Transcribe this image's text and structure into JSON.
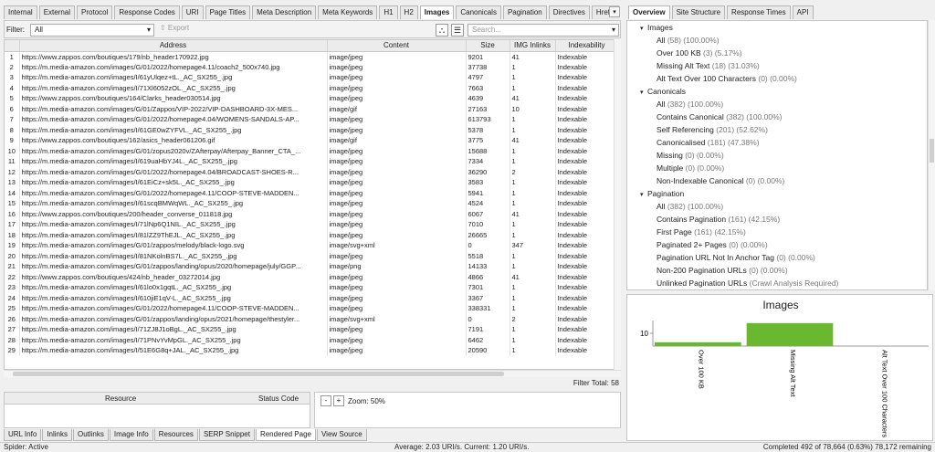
{
  "left_tabs": [
    "Internal",
    "External",
    "Protocol",
    "Response Codes",
    "URI",
    "Page Titles",
    "Meta Description",
    "Meta Keywords",
    "H1",
    "H2",
    "Images",
    "Canonicals",
    "Pagination",
    "Directives",
    "Hreflang"
  ],
  "left_active": 10,
  "chevron": "▾",
  "right_tabs": [
    "Overview",
    "Site Structure",
    "Response Times",
    "API"
  ],
  "right_active": 0,
  "filter": {
    "label": "Filter:",
    "value": "All",
    "arrow": "▾",
    "export": "⇧ Export",
    "search_placeholder": "Search..."
  },
  "icons": {
    "tree": "⛬",
    "list": "☰"
  },
  "columns": [
    "",
    "Address",
    "Content",
    "Size",
    "IMG Inlinks",
    "Indexability"
  ],
  "rows": [
    [
      "1",
      "https://www.zappos.com/boutiques/179/nb_header170922.jpg",
      "image/jpeg",
      "9201",
      "41",
      "Indexable"
    ],
    [
      "2",
      "https://m.media-amazon.com/images/G/01/2022/homepage4.11/coach2_500x740.jpg",
      "image/jpeg",
      "37738",
      "1",
      "Indexable"
    ],
    [
      "3",
      "https://m.media-amazon.com/images/I/61yUlqez+tL._AC_SX255_.jpg",
      "image/jpeg",
      "4797",
      "1",
      "Indexable"
    ],
    [
      "4",
      "https://m.media-amazon.com/images/I/71Xl6052zOL._AC_SX255_.jpg",
      "image/jpeg",
      "7663",
      "1",
      "Indexable"
    ],
    [
      "5",
      "https://www.zappos.com/boutiques/164/Clarks_header030514.jpg",
      "image/jpeg",
      "4639",
      "41",
      "Indexable"
    ],
    [
      "6",
      "https://m.media-amazon.com/images/G/01/Zappos/VIP-2022/VIP-DASHBOARD-3X-MES...",
      "image/gif",
      "27163",
      "10",
      "Indexable"
    ],
    [
      "7",
      "https://m.media-amazon.com/images/G/01/2022/homepage4.04/WOMENS-SANDALS-AP...",
      "image/jpeg",
      "613793",
      "1",
      "Indexable"
    ],
    [
      "8",
      "https://m.media-amazon.com/images/I/61GE0wZYFVL._AC_SX255_.jpg",
      "image/jpeg",
      "5378",
      "1",
      "Indexable"
    ],
    [
      "9",
      "https://www.zappos.com/boutiques/162/asics_header061206.gif",
      "image/gif",
      "3775",
      "41",
      "Indexable"
    ],
    [
      "10",
      "https://m.media-amazon.com/images/G/01/zopus2020v/ZAfterpay/Afterpay_Banner_CTA_...",
      "image/jpeg",
      "15688",
      "1",
      "Indexable"
    ],
    [
      "11",
      "https://m.media-amazon.com/images/I/619uaHbYJ4L._AC_SX255_.jpg",
      "image/jpeg",
      "7334",
      "1",
      "Indexable"
    ],
    [
      "12",
      "https://m.media-amazon.com/images/G/01/2022/homepage4.04/BROADCAST-SHOES-R...",
      "image/jpeg",
      "36290",
      "2",
      "Indexable"
    ],
    [
      "13",
      "https://m.media-amazon.com/images/I/61EiCz+sk5L._AC_SX255_.jpg",
      "image/jpeg",
      "3583",
      "1",
      "Indexable"
    ],
    [
      "14",
      "https://m.media-amazon.com/images/G/01/2022/homepage4.11/COOP-STEVE-MADDEN...",
      "image/jpeg",
      "5941",
      "1",
      "Indexable"
    ],
    [
      "15",
      "https://m.media-amazon.com/images/I/61scqBMWqWL._AC_SX255_.jpg",
      "image/jpeg",
      "4524",
      "1",
      "Indexable"
    ],
    [
      "16",
      "https://www.zappos.com/boutiques/200/header_converse_011818.jpg",
      "image/jpeg",
      "6067",
      "41",
      "Indexable"
    ],
    [
      "17",
      "https://m.media-amazon.com/images/I/71lNp6Q1NIL._AC_SX255_.jpg",
      "image/jpeg",
      "7010",
      "1",
      "Indexable"
    ],
    [
      "18",
      "https://m.media-amazon.com/images/I/81lZZ9ThEJL._AC_SX255_.jpg",
      "image/jpeg",
      "26665",
      "1",
      "Indexable"
    ],
    [
      "19",
      "https://m.media-amazon.com/images/G/01/zappos/melody/black-logo.svg",
      "image/svg+xml",
      "0",
      "347",
      "Indexable"
    ],
    [
      "20",
      "https://m.media-amazon.com/images/I/81NKolnBS7L._AC_SX255_.jpg",
      "image/jpeg",
      "5518",
      "1",
      "Indexable"
    ],
    [
      "21",
      "https://m.media-amazon.com/images/G/01/zappos/landing/opus/2020/homepage/july/GGP...",
      "image/png",
      "14133",
      "1",
      "Indexable"
    ],
    [
      "22",
      "https://www.zappos.com/boutiques/424/nb_header_03272014.jpg",
      "image/jpeg",
      "4866",
      "41",
      "Indexable"
    ],
    [
      "23",
      "https://m.media-amazon.com/images/I/61lo0x1gqtL._AC_SX255_.jpg",
      "image/jpeg",
      "7301",
      "1",
      "Indexable"
    ],
    [
      "24",
      "https://m.media-amazon.com/images/I/610jiE1qV-L._AC_SX255_.jpg",
      "image/jpeg",
      "3367",
      "1",
      "Indexable"
    ],
    [
      "25",
      "https://m.media-amazon.com/images/G/01/2022/homepage4.11/COOP-STEVE-MADDEN...",
      "image/jpeg",
      "338331",
      "1",
      "Indexable"
    ],
    [
      "26",
      "https://m.media-amazon.com/images/G/01/zappos/landing/opus/2021/homepage/thestyler...",
      "image/svg+xml",
      "0",
      "2",
      "Indexable"
    ],
    [
      "27",
      "https://m.media-amazon.com/images/I/71ZJ8J1oBgL._AC_SX255_.jpg",
      "image/jpeg",
      "7191",
      "1",
      "Indexable"
    ],
    [
      "28",
      "https://m.media-amazon.com/images/I/71PNvYvMpGL._AC_SX255_.jpg",
      "image/jpeg",
      "6462",
      "1",
      "Indexable"
    ],
    [
      "29",
      "https://m.media-amazon.com/images/I/51E6G8q+JAL._AC_SX255_.jpg",
      "image/jpeg",
      "20590",
      "1",
      "Indexable"
    ]
  ],
  "filter_total": "Filter Total:  58",
  "bottom_left": {
    "resource": "Resource",
    "status": "Status Code"
  },
  "zoom": {
    "out": "-",
    "in": "+",
    "label": "Zoom: 50%"
  },
  "bottom_tabs": [
    "URL Info",
    "Inlinks",
    "Outlinks",
    "Image Info",
    "Resources",
    "SERP Snippet",
    "Rendered Page",
    "View Source"
  ],
  "bottom_active": 6,
  "status": {
    "left": "Spider: Active",
    "mid": "Average: 2.03 URI/s. Current: 1.20 URI/s.",
    "right": "Completed 492 of 78,664 (0.63%) 78,172 remaining"
  },
  "overview": [
    {
      "title": "Images",
      "items": [
        [
          "All",
          "(58) (100.00%)"
        ],
        [
          "Over 100 KB",
          "(3) (5.17%)"
        ],
        [
          "Missing Alt Text",
          "(18) (31.03%)"
        ],
        [
          "Alt Text Over 100 Characters",
          "(0) (0.00%)"
        ]
      ]
    },
    {
      "title": "Canonicals",
      "items": [
        [
          "All",
          "(382) (100.00%)"
        ],
        [
          "Contains Canonical",
          "(382) (100.00%)"
        ],
        [
          "Self Referencing",
          "(201) (52.62%)"
        ],
        [
          "Canonicalised",
          "(181) (47.38%)"
        ],
        [
          "Missing",
          "(0) (0.00%)"
        ],
        [
          "Multiple",
          "(0) (0.00%)"
        ],
        [
          "Non-Indexable Canonical",
          "(0) (0.00%)"
        ]
      ]
    },
    {
      "title": "Pagination",
      "items": [
        [
          "All",
          "(382) (100.00%)"
        ],
        [
          "Contains Pagination",
          "(161) (42.15%)"
        ],
        [
          "First Page",
          "(161) (42.15%)"
        ],
        [
          "Paginated 2+ Pages",
          "(0) (0.00%)"
        ],
        [
          "Pagination URL Not In Anchor Tag",
          "(0) (0.00%)"
        ],
        [
          "Non-200 Pagination URLs",
          "(0) (0.00%)"
        ],
        [
          "Unlinked Pagination URLs",
          "(Crawl Analysis Required)"
        ]
      ]
    }
  ],
  "chart_data": {
    "type": "bar",
    "title": "Images",
    "categories": [
      "Over 100 KB",
      "Missing Alt Text",
      "Alt Text Over 100 Characters"
    ],
    "values": [
      3,
      18,
      0
    ],
    "yticks": [
      10
    ],
    "ylim": [
      0,
      20
    ],
    "color": "#6ab82f"
  }
}
